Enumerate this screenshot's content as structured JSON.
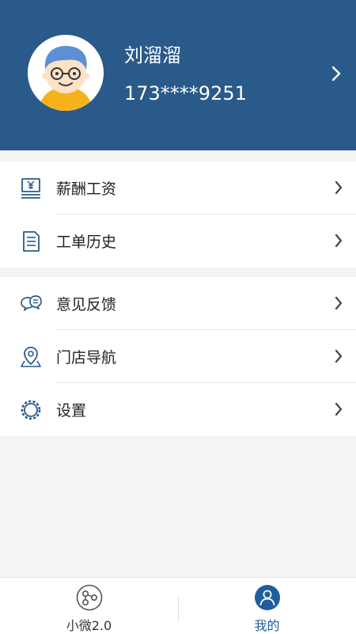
{
  "profile": {
    "name": "刘溜溜",
    "phone": "173****9251"
  },
  "menu_group_1": [
    {
      "label": "薪酬工资",
      "icon": "salary-icon"
    },
    {
      "label": "工单历史",
      "icon": "document-icon"
    }
  ],
  "menu_group_2": [
    {
      "label": "意见反馈",
      "icon": "feedback-icon"
    },
    {
      "label": "门店导航",
      "icon": "location-pin-icon"
    },
    {
      "label": "设置",
      "icon": "gear-icon"
    }
  ],
  "tabs": [
    {
      "label": "小微2.0",
      "icon": "share-nodes-icon",
      "active": false
    },
    {
      "label": "我的",
      "icon": "user-icon",
      "active": true
    }
  ],
  "colors": {
    "header": "#2a5a8a",
    "accent": "#1f5fa0",
    "icon": "#2a5a8a"
  }
}
